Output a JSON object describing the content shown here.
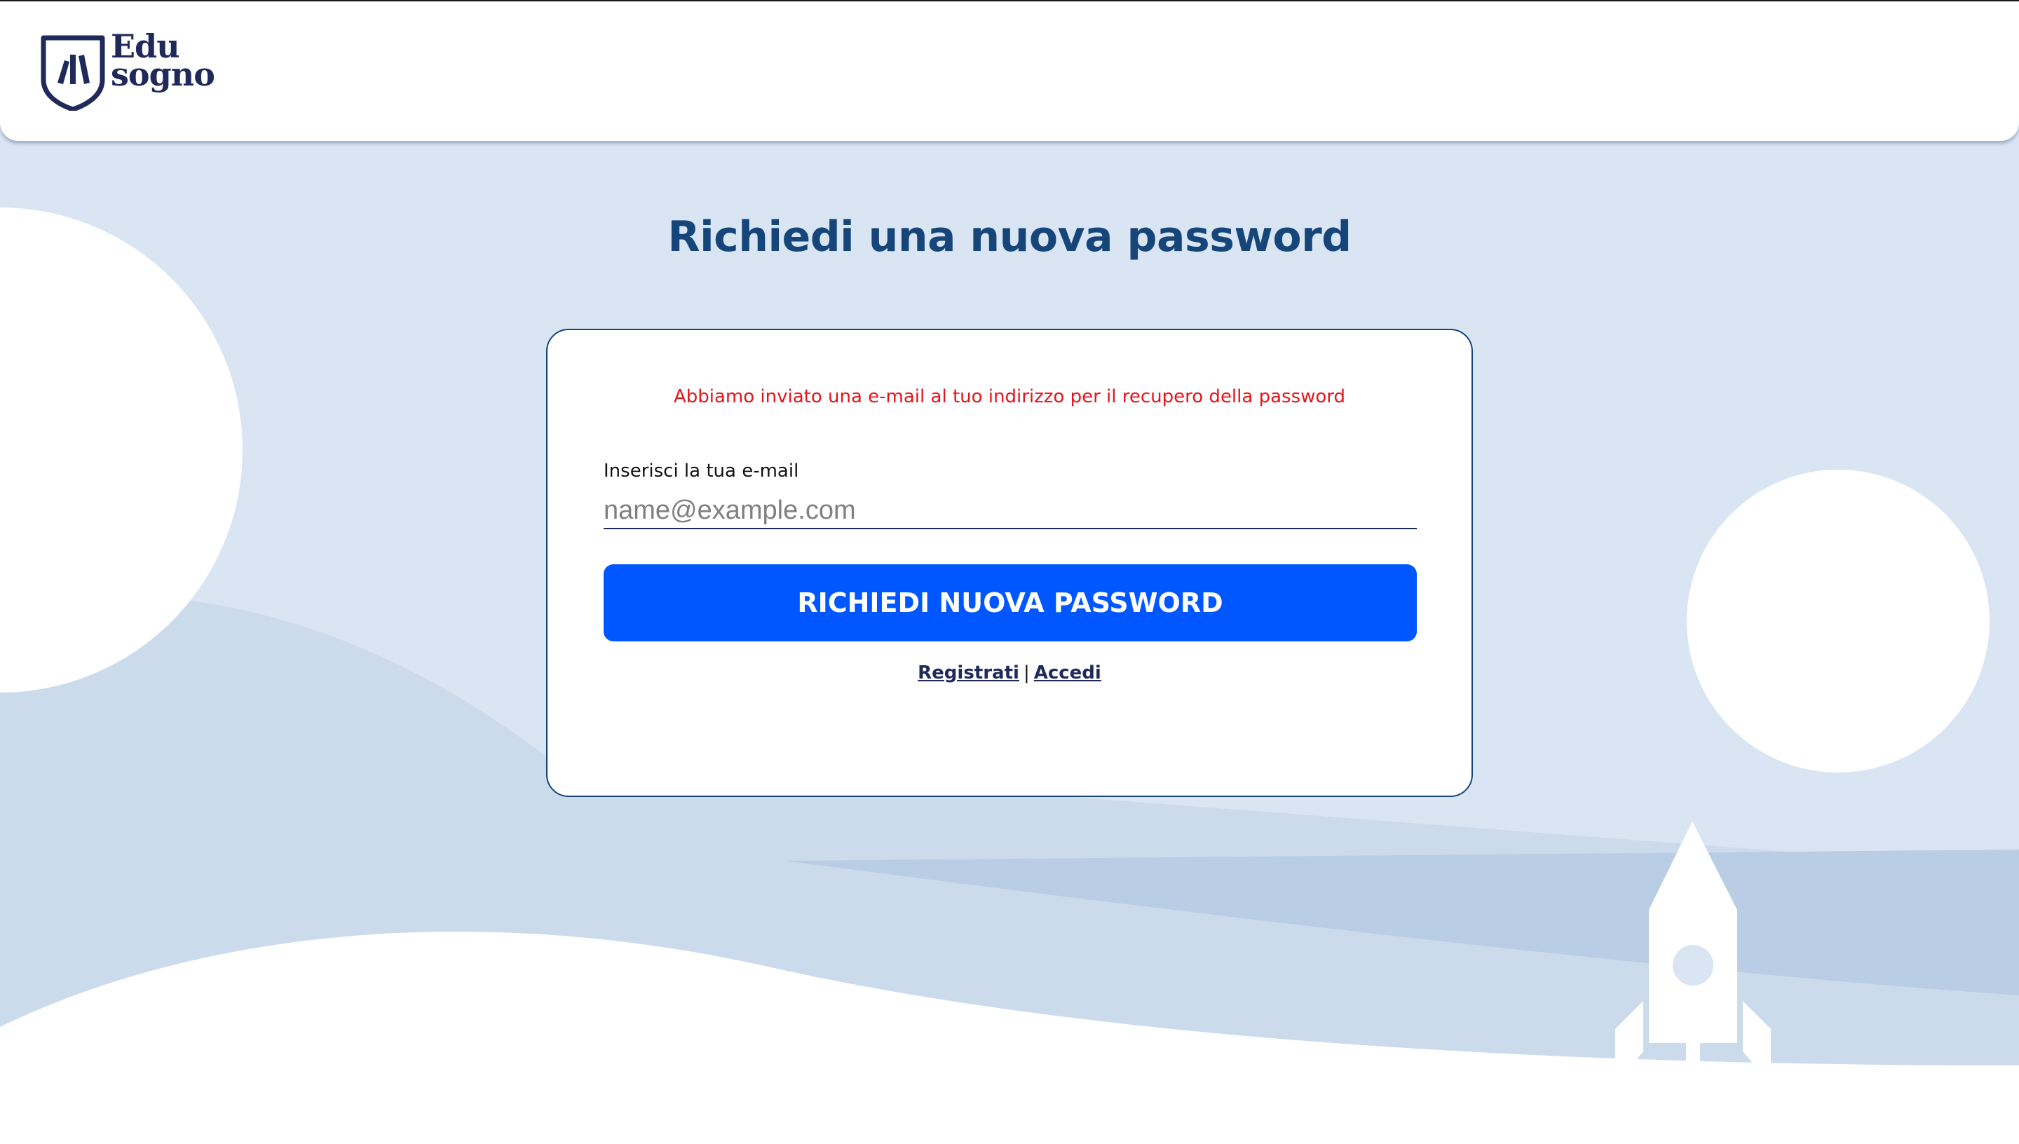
{
  "header": {
    "logo_line1": "Edu",
    "logo_line2": "sogno"
  },
  "page": {
    "title": "Richiedi una nuova password"
  },
  "form": {
    "notice": "Abbiamo inviato una e-mail al tuo indirizzo per il recupero della password",
    "email_label": "Inserisci la tua e-mail",
    "email_value": "",
    "email_placeholder": "name@example.com",
    "submit_label": "RICHIEDI NUOVA PASSWORD"
  },
  "links": {
    "register": "Registrati",
    "separator": "|",
    "login": "Accedi"
  },
  "colors": {
    "background": "#d9e5f3",
    "title": "#16457a",
    "notice": "#e5141b",
    "button": "#0057ff",
    "logo": "#1f2a5a"
  }
}
